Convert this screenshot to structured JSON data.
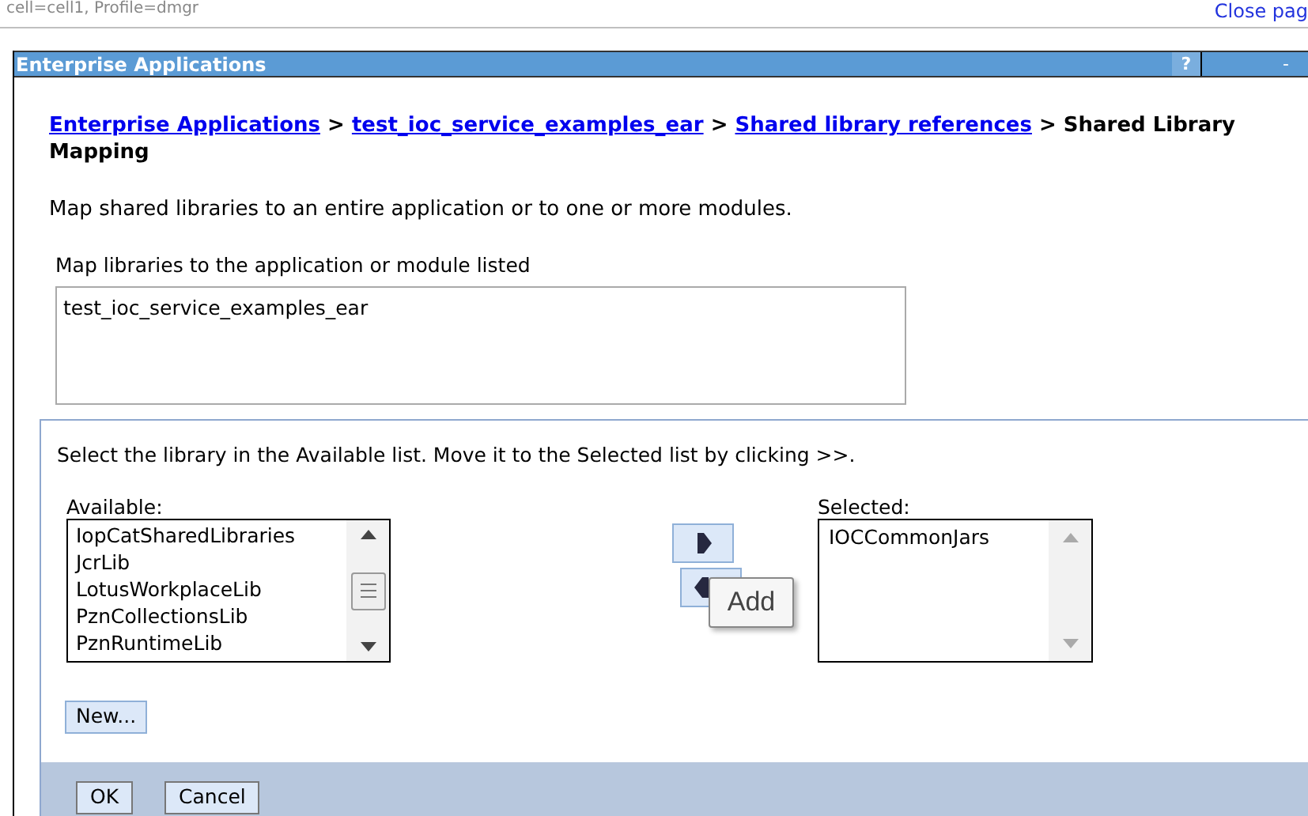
{
  "top_bar": {
    "context": "cell=cell1, Profile=dmgr",
    "close_link": "Close pag"
  },
  "window": {
    "title": "Enterprise Applications",
    "help": "?",
    "minimize": "-"
  },
  "breadcrumb": {
    "links": [
      "Enterprise Applications",
      "test_ioc_service_examples_ear",
      "Shared library references"
    ],
    "separator": ">",
    "current": "Shared Library Mapping"
  },
  "description": "Map shared libraries to an entire application or to one or more modules.",
  "module_list": {
    "label": "Map libraries to the application or module listed",
    "items": [
      "test_ioc_service_examples_ear"
    ]
  },
  "instruction": "Select the library in the Available list. Move it to the Selected list by clicking >>.",
  "available": {
    "label": "Available:",
    "items": [
      "IopCatSharedLibraries",
      "JcrLib",
      "LotusWorkplaceLib",
      "PznCollectionsLib",
      "PznRuntimeLib"
    ]
  },
  "selected": {
    "label": "Selected:",
    "items": [
      "IOCCommonJars"
    ]
  },
  "tooltip": "Add",
  "new_button": "New...",
  "buttons": [
    "OK",
    "Cancel"
  ]
}
